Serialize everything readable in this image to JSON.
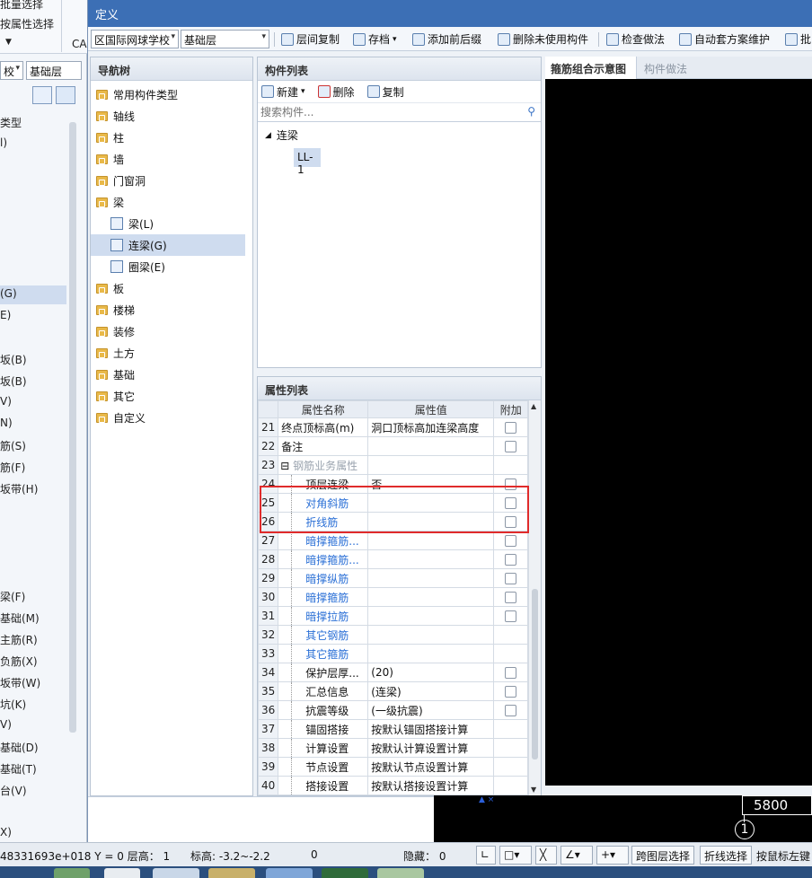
{
  "background": {
    "ribbon_items": [
      "批量选择",
      "按属性选择",
      "CA"
    ],
    "combo_left": "校",
    "combo_floor": "基础层",
    "tree_items": [
      "类型",
      "l)",
      "(G)",
      "E)",
      "坂(B)",
      "坂(B)",
      "V)",
      "N)",
      "筋(S)",
      "筋(F)",
      "坂带(H)",
      "梁(F)",
      "基础(M)",
      "主筋(R)",
      "负筋(X)",
      "坂带(W)",
      "坑(K)",
      "V)",
      "基础(D)",
      "基础(T)",
      "台(V)",
      "X)"
    ]
  },
  "dialog": {
    "title": "定义",
    "toolbar": {
      "project_combo": "区国际网球学校",
      "floor_combo": "基础层",
      "buttons": [
        "层间复制",
        "存档",
        "添加前后缀",
        "删除未使用构件",
        "检查做法",
        "自动套方案维护",
        "批"
      ]
    },
    "nav": {
      "header": "导航树",
      "items": [
        {
          "label": "常用构件类型",
          "level": 0
        },
        {
          "label": "轴线",
          "level": 0
        },
        {
          "label": "柱",
          "level": 0
        },
        {
          "label": "墙",
          "level": 0
        },
        {
          "label": "门窗洞",
          "level": 0
        },
        {
          "label": "梁",
          "level": 0
        },
        {
          "label": "梁(L)",
          "level": 1
        },
        {
          "label": "连梁(G)",
          "level": 1,
          "selected": true
        },
        {
          "label": "圈梁(E)",
          "level": 1
        },
        {
          "label": "板",
          "level": 0
        },
        {
          "label": "楼梯",
          "level": 0
        },
        {
          "label": "装修",
          "level": 0
        },
        {
          "label": "土方",
          "level": 0
        },
        {
          "label": "基础",
          "level": 0
        },
        {
          "label": "其它",
          "level": 0
        },
        {
          "label": "自定义",
          "level": 0
        }
      ]
    },
    "components": {
      "header": "构件列表",
      "new_label": "新建",
      "delete_label": "删除",
      "copy_label": "复制",
      "search_placeholder": "搜索构件...",
      "tree_root": "连梁",
      "tree_child": "LL-1"
    },
    "properties": {
      "header": "属性列表",
      "columns": [
        "属性名称",
        "属性值",
        "附加"
      ],
      "rows": [
        {
          "num": "21",
          "name": "终点顶标高(m)",
          "value": "洞口顶标高加连梁高度",
          "check": true,
          "style": "normal"
        },
        {
          "num": "22",
          "name": "备注",
          "value": "",
          "check": true,
          "style": "normal"
        },
        {
          "num": "23",
          "name": "钢筋业务属性",
          "value": "",
          "check": false,
          "style": "group"
        },
        {
          "num": "24",
          "name": "顶层连梁",
          "value": "否",
          "check": true,
          "style": "indent"
        },
        {
          "num": "25",
          "name": "对角斜筋",
          "value": "",
          "check": true,
          "style": "blue"
        },
        {
          "num": "26",
          "name": "折线筋",
          "value": "",
          "check": true,
          "style": "blue"
        },
        {
          "num": "27",
          "name": "暗撑箍筋...",
          "value": "",
          "check": true,
          "style": "blue"
        },
        {
          "num": "28",
          "name": "暗撑箍筋...",
          "value": "",
          "check": true,
          "style": "blue"
        },
        {
          "num": "29",
          "name": "暗撑纵筋",
          "value": "",
          "check": true,
          "style": "blue"
        },
        {
          "num": "30",
          "name": "暗撑箍筋",
          "value": "",
          "check": true,
          "style": "blue"
        },
        {
          "num": "31",
          "name": "暗撑拉筋",
          "value": "",
          "check": true,
          "style": "blue"
        },
        {
          "num": "32",
          "name": "其它钢筋",
          "value": "",
          "check": false,
          "style": "blue"
        },
        {
          "num": "33",
          "name": "其它箍筋",
          "value": "",
          "check": false,
          "style": "blue"
        },
        {
          "num": "34",
          "name": "保护层厚...",
          "value": "(20)",
          "check": true,
          "style": "indent"
        },
        {
          "num": "35",
          "name": "汇总信息",
          "value": "(连梁)",
          "check": true,
          "style": "indent"
        },
        {
          "num": "36",
          "name": "抗震等级",
          "value": "(一级抗震)",
          "check": true,
          "style": "indent"
        },
        {
          "num": "37",
          "name": "锚固搭接",
          "value": "按默认锚固搭接计算",
          "check": false,
          "style": "indent"
        },
        {
          "num": "38",
          "name": "计算设置",
          "value": "按默认计算设置计算",
          "check": false,
          "style": "indent"
        },
        {
          "num": "39",
          "name": "节点设置",
          "value": "按默认节点设置计算",
          "check": false,
          "style": "indent"
        },
        {
          "num": "40",
          "name": "搭接设置",
          "value": "按默认搭接设置计算",
          "check": false,
          "style": "indent"
        }
      ]
    },
    "right_tabs": [
      "箍筋组合示意图",
      "构件做法"
    ]
  },
  "canvas": {
    "dimension": "5800",
    "axis_label": "1"
  },
  "status": {
    "coords": "48331693e+018 Y = 0 层高： 1",
    "elev": "标高: -3.2~-2.2",
    "zero": "0",
    "hidden": "隐藏： 0",
    "btn_cross_layer": "跨图层选择",
    "btn_polyline": "折线选择",
    "hint": "按鼠标左键"
  }
}
